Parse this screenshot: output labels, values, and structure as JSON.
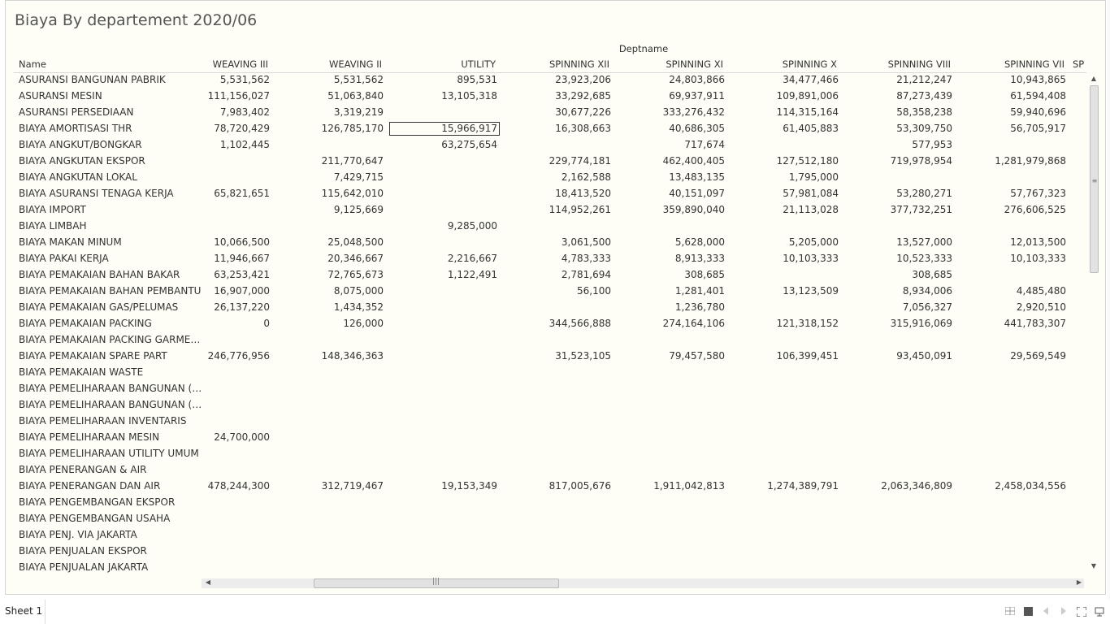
{
  "title": "Biaya By departement 2020/06",
  "column_group_label": "Deptname",
  "name_header": "Name",
  "columns": [
    "WEAVING III",
    "WEAVING II",
    "UTILITY",
    "SPINNING XII",
    "SPINNING XI",
    "SPINNING X",
    "SPINNING VIII",
    "SPINNING VII",
    "SP"
  ],
  "rows": [
    {
      "name": "ASURANSI BANGUNAN PABRIK",
      "values": [
        "5,531,562",
        "5,531,562",
        "895,531",
        "23,923,206",
        "24,803,866",
        "34,477,466",
        "21,212,247",
        "10,943,865"
      ]
    },
    {
      "name": "ASURANSI MESIN",
      "values": [
        "111,156,027",
        "51,063,840",
        "13,105,318",
        "33,292,685",
        "69,937,911",
        "109,891,006",
        "87,273,439",
        "61,594,408"
      ]
    },
    {
      "name": "ASURANSI PERSEDIAAN",
      "values": [
        "7,983,402",
        "3,319,219",
        "",
        "30,677,226",
        "333,276,432",
        "114,315,164",
        "58,358,238",
        "59,940,696"
      ]
    },
    {
      "name": "BIAYA AMORTISASI THR",
      "values": [
        "78,720,429",
        "126,785,170",
        "15,966,917",
        "16,308,663",
        "40,686,305",
        "61,405,883",
        "53,309,750",
        "56,705,917"
      ]
    },
    {
      "name": "BIAYA ANGKUT/BONGKAR",
      "values": [
        "1,102,445",
        "",
        "63,275,654",
        "",
        "717,674",
        "",
        "577,953",
        ""
      ]
    },
    {
      "name": "BIAYA ANGKUTAN EKSPOR",
      "values": [
        "",
        "211,770,647",
        "",
        "229,774,181",
        "462,400,405",
        "127,512,180",
        "719,978,954",
        "1,281,979,868"
      ]
    },
    {
      "name": "BIAYA ANGKUTAN LOKAL",
      "values": [
        "",
        "7,429,715",
        "",
        "2,162,588",
        "13,483,135",
        "1,795,000",
        "",
        ""
      ]
    },
    {
      "name": "BIAYA ASURANSI TENAGA KERJA",
      "values": [
        "65,821,651",
        "115,642,010",
        "",
        "18,413,520",
        "40,151,097",
        "57,981,084",
        "53,280,271",
        "57,767,323"
      ]
    },
    {
      "name": "BIAYA IMPORT",
      "values": [
        "",
        "9,125,669",
        "",
        "114,952,261",
        "359,890,040",
        "21,113,028",
        "377,732,251",
        "276,606,525"
      ]
    },
    {
      "name": "BIAYA LIMBAH",
      "values": [
        "",
        "",
        "9,285,000",
        "",
        "",
        "",
        "",
        ""
      ]
    },
    {
      "name": "BIAYA MAKAN MINUM",
      "values": [
        "10,066,500",
        "25,048,500",
        "",
        "3,061,500",
        "5,628,000",
        "5,205,000",
        "13,527,000",
        "12,013,500"
      ]
    },
    {
      "name": "BIAYA PAKAI KERJA",
      "values": [
        "11,946,667",
        "20,346,667",
        "2,216,667",
        "4,783,333",
        "8,913,333",
        "10,103,333",
        "10,523,333",
        "10,103,333"
      ]
    },
    {
      "name": "BIAYA PEMAKAIAN BAHAN BAKAR",
      "values": [
        "63,253,421",
        "72,765,673",
        "1,122,491",
        "2,781,694",
        "308,685",
        "",
        "308,685",
        ""
      ]
    },
    {
      "name": "BIAYA PEMAKAIAN BAHAN PEMBANTU",
      "values": [
        "16,907,000",
        "8,075,000",
        "",
        "56,100",
        "1,281,401",
        "13,123,509",
        "8,934,006",
        "4,485,480"
      ]
    },
    {
      "name": "BIAYA PEMAKAIAN GAS/PELUMAS",
      "values": [
        "26,137,220",
        "1,434,352",
        "",
        "",
        "1,236,780",
        "",
        "7,056,327",
        "2,920,510"
      ]
    },
    {
      "name": "BIAYA PEMAKAIAN PACKING",
      "values": [
        "0",
        "126,000",
        "",
        "344,566,888",
        "274,164,106",
        "121,318,152",
        "315,916,069",
        "441,783,307"
      ]
    },
    {
      "name": "BIAYA PEMAKAIAN PACKING GARMENT",
      "values": [
        "",
        "",
        "",
        "",
        "",
        "",
        "",
        ""
      ]
    },
    {
      "name": "BIAYA PEMAKAIAN SPARE PART",
      "values": [
        "246,776,956",
        "148,346,363",
        "",
        "31,523,105",
        "79,457,580",
        "106,399,451",
        "93,450,091",
        "29,569,549"
      ]
    },
    {
      "name": "BIAYA PEMAKAIAN WASTE",
      "values": [
        "",
        "",
        "",
        "",
        "",
        "",
        "",
        ""
      ]
    },
    {
      "name": "BIAYA PEMELIHARAAN BANGUNAN ( O..",
      "values": [
        "",
        "",
        "",
        "",
        "",
        "",
        "",
        ""
      ]
    },
    {
      "name": "BIAYA PEMELIHARAAN BANGUNAN (A..",
      "values": [
        "",
        "",
        "",
        "",
        "",
        "",
        "",
        ""
      ]
    },
    {
      "name": "BIAYA PEMELIHARAAN INVENTARIS",
      "values": [
        "",
        "",
        "",
        "",
        "",
        "",
        "",
        ""
      ]
    },
    {
      "name": "BIAYA PEMELIHARAAN MESIN",
      "values": [
        "24,700,000",
        "",
        "",
        "",
        "",
        "",
        "",
        ""
      ]
    },
    {
      "name": "BIAYA PEMELIHARAAN UTILITY UMUM",
      "values": [
        "",
        "",
        "",
        "",
        "",
        "",
        "",
        ""
      ]
    },
    {
      "name": "BIAYA PENERANGAN & AIR",
      "values": [
        "",
        "",
        "",
        "",
        "",
        "",
        "",
        ""
      ]
    },
    {
      "name": "BIAYA PENERANGAN DAN AIR",
      "values": [
        "478,244,300",
        "312,719,467",
        "19,153,349",
        "817,005,676",
        "1,911,042,813",
        "1,274,389,791",
        "2,063,346,809",
        "2,458,034,556"
      ]
    },
    {
      "name": "BIAYA PENGEMBANGAN EKSPOR",
      "values": [
        "",
        "",
        "",
        "",
        "",
        "",
        "",
        ""
      ]
    },
    {
      "name": "BIAYA PENGEMBANGAN USAHA",
      "values": [
        "",
        "",
        "",
        "",
        "",
        "",
        "",
        ""
      ]
    },
    {
      "name": "BIAYA PENJ. VIA JAKARTA",
      "values": [
        "",
        "",
        "",
        "",
        "",
        "",
        "",
        ""
      ]
    },
    {
      "name": "BIAYA PENJUALAN EKSPOR",
      "values": [
        "",
        "",
        "",
        "",
        "",
        "",
        "",
        ""
      ]
    },
    {
      "name": "BIAYA PENJUALAN JAKARTA",
      "values": [
        "",
        "",
        "",
        "",
        "",
        "",
        "",
        ""
      ]
    }
  ],
  "selected_cell": {
    "row": 3,
    "col": 2
  },
  "scrollbars": {
    "vertical_grip": "≡",
    "horizontal_grip": "|||",
    "up": "▲",
    "down": "▼",
    "left": "◀",
    "right": "▶"
  },
  "bottom": {
    "sheet_tab": "Sheet 1",
    "icons": [
      "grid-icon",
      "square-icon",
      "prev-icon",
      "next-icon",
      "fullscreen-icon",
      "present-icon"
    ]
  }
}
